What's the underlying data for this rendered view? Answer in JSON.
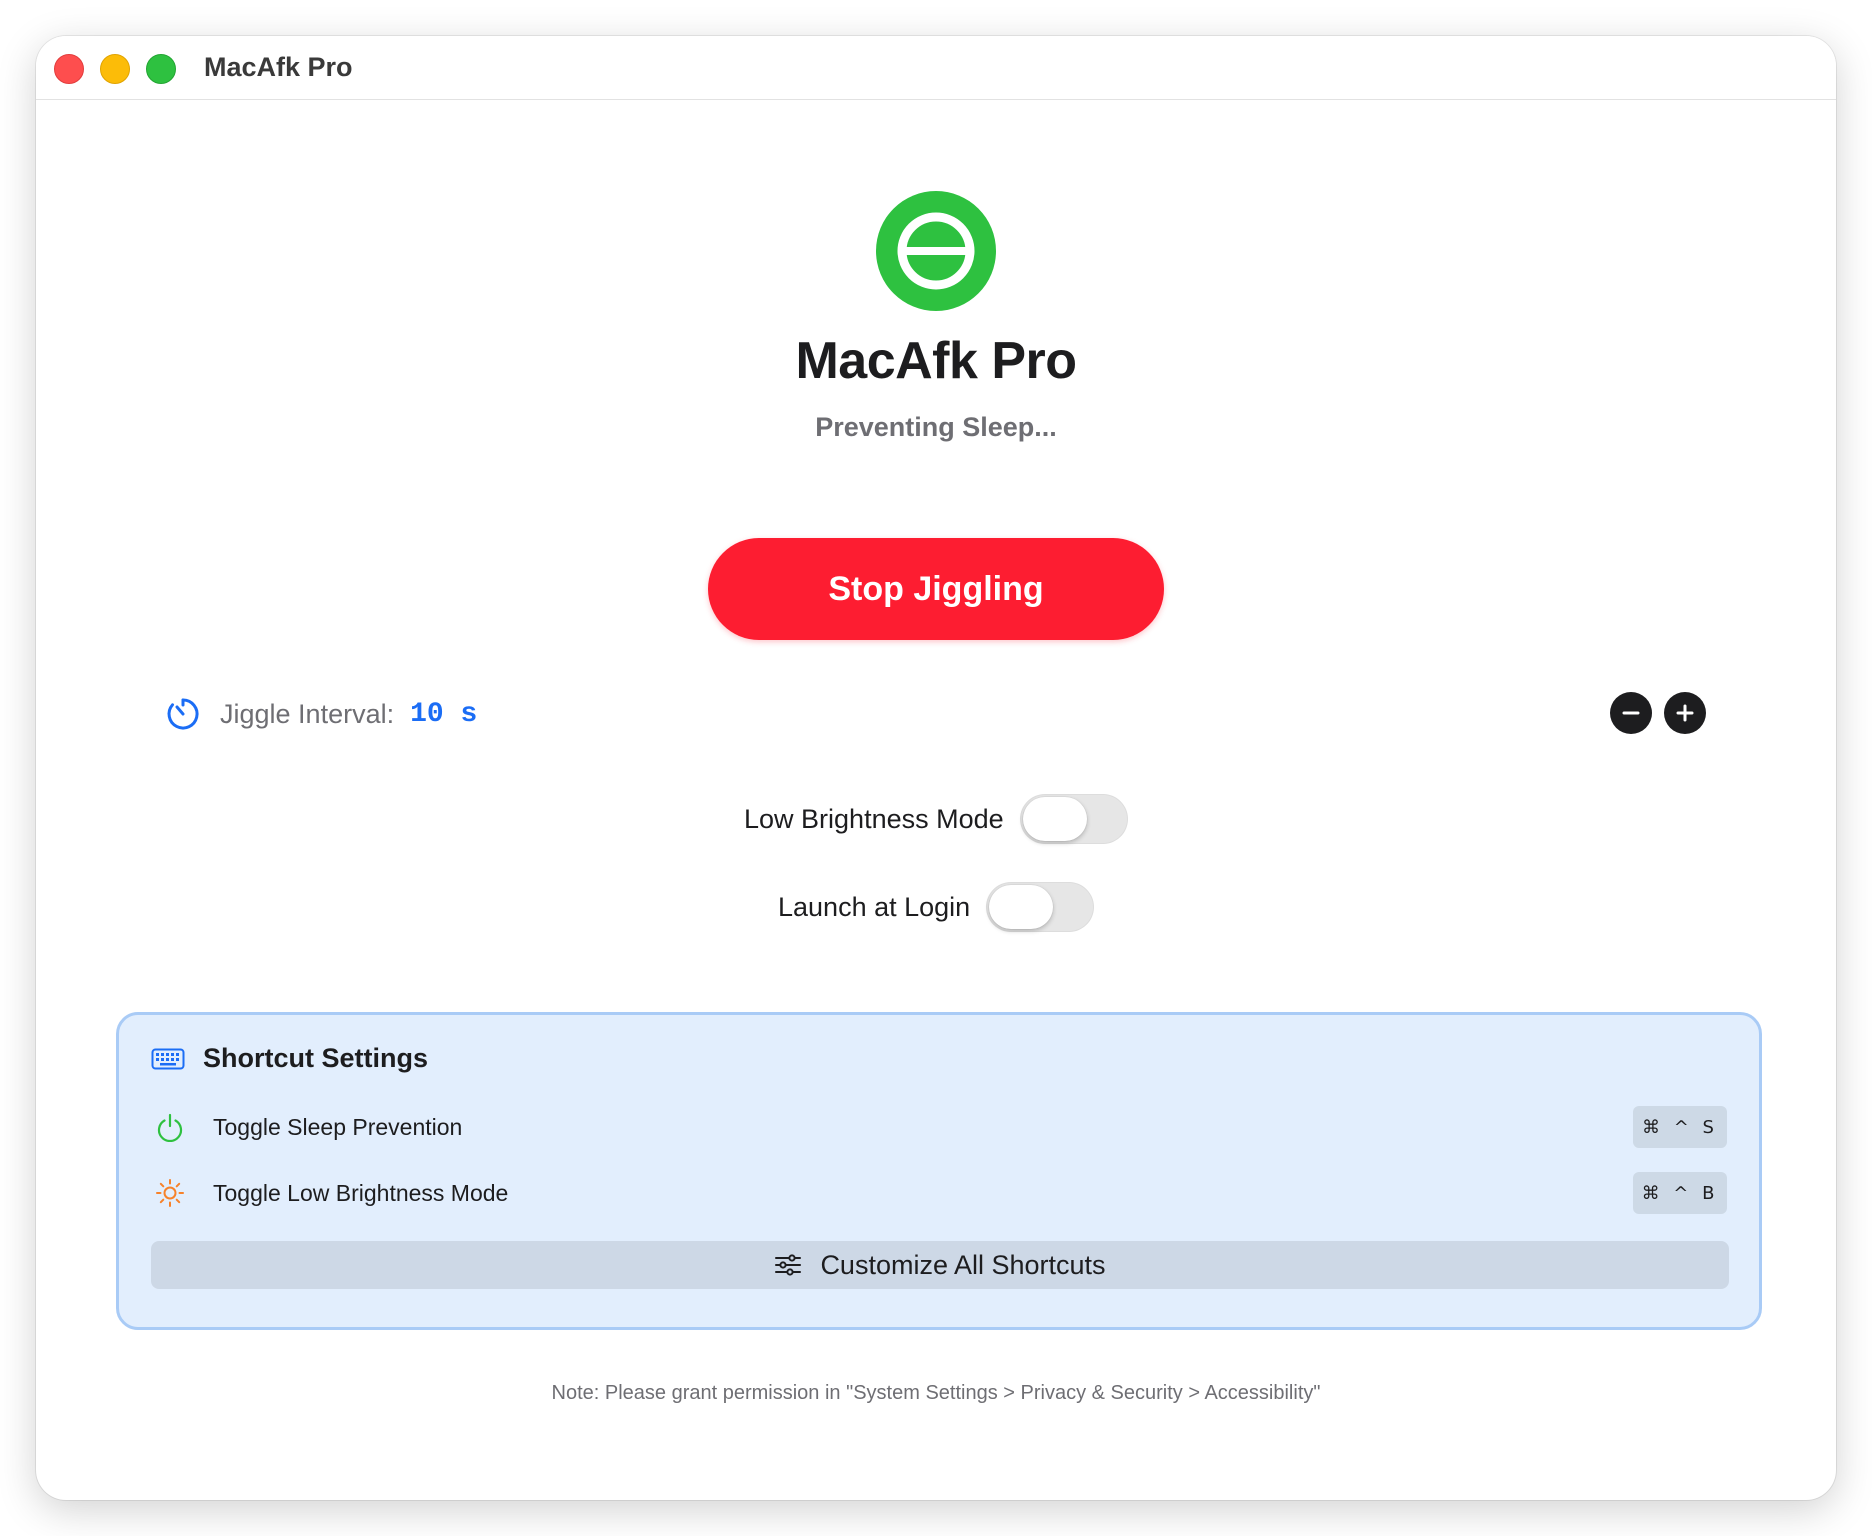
{
  "window": {
    "title": "MacAfk Pro",
    "controls": [
      "close",
      "minimize",
      "zoom"
    ]
  },
  "header": {
    "logo_icon": "sleep-indicator-icon",
    "app_name": "MacAfk Pro",
    "status": "Preventing Sleep..."
  },
  "actions": {
    "stop_label": "Stop Jiggling"
  },
  "interval": {
    "icon": "timer-icon",
    "label": "Jiggle Interval:",
    "value": "10 s",
    "decrement_icon": "minus-icon",
    "increment_icon": "plus-icon"
  },
  "toggles": [
    {
      "label": "Low Brightness Mode",
      "on": false
    },
    {
      "label": "Launch at Login",
      "on": false
    }
  ],
  "shortcuts": {
    "title": "Shortcut Settings",
    "icon": "keyboard-icon",
    "items": [
      {
        "icon": "power-icon",
        "label": "Toggle Sleep Prevention",
        "keys": "⌘ ^ S"
      },
      {
        "icon": "sun-icon",
        "label": "Toggle Low Brightness Mode",
        "keys": "⌘ ^ B"
      }
    ],
    "customize_label": "Customize All Shortcuts"
  },
  "footer": {
    "note": "Note: Please grant permission in \"System Settings > Privacy & Security > Accessibility\""
  },
  "colors": {
    "accent_green": "#2ec140",
    "stop_red": "#fd1d31",
    "interval_blue": "#1b6df5",
    "panel_bg": "#e2eefd",
    "panel_border": "#a9cbf6"
  }
}
